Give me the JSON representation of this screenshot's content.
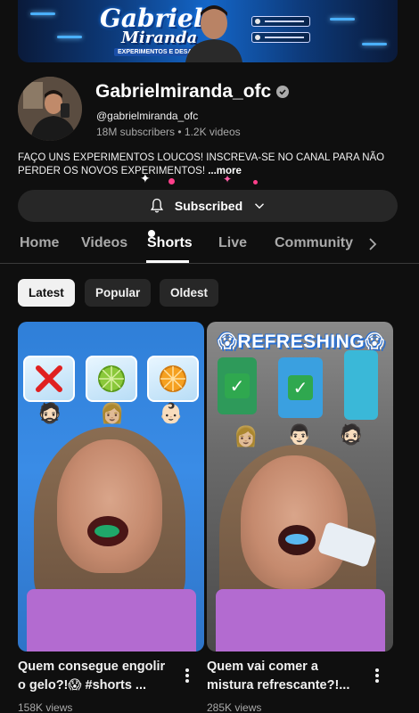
{
  "banner": {
    "logo_line1": "Gabriel",
    "logo_line2": "Miranda",
    "tagline": "EXPERIMENTOS E DESAFIOS"
  },
  "channel": {
    "name": "Gabrielmiranda_ofc",
    "handle": "@gabrielmiranda_ofc",
    "subscribers": "18M subscribers",
    "videos": "1.2K videos",
    "meta_separator": " • ",
    "description": "FAÇO UNS EXPERIMENTOS LOUCOS! INSCREVA-SE NO CANAL PARA NÃO PERDER OS NOVOS EXPERIMENTOS!",
    "more_label": " ...more"
  },
  "subscribe": {
    "label": "Subscribed"
  },
  "tabs": [
    {
      "label": "Home",
      "active": false
    },
    {
      "label": "Videos",
      "active": false
    },
    {
      "label": "Shorts",
      "active": true
    },
    {
      "label": "Live",
      "active": false
    },
    {
      "label": "Community",
      "active": false
    }
  ],
  "filters": [
    {
      "label": "Latest",
      "active": true
    },
    {
      "label": "Popular",
      "active": false
    },
    {
      "label": "Oldest",
      "active": false
    }
  ],
  "shorts": [
    {
      "title": "Quem consegue engolir o gelo?!😱 #shorts ...",
      "views": "158K views"
    },
    {
      "title": "Quem vai comer a mistura refrescante?!...",
      "views": "285K views",
      "overlay_text": "REFRESHING"
    }
  ],
  "colors": {
    "background": "#0f0f0f",
    "chip_active_bg": "#f1f1f1",
    "chip_inactive_bg": "#272727",
    "secondary_text": "#aaaaaa"
  }
}
